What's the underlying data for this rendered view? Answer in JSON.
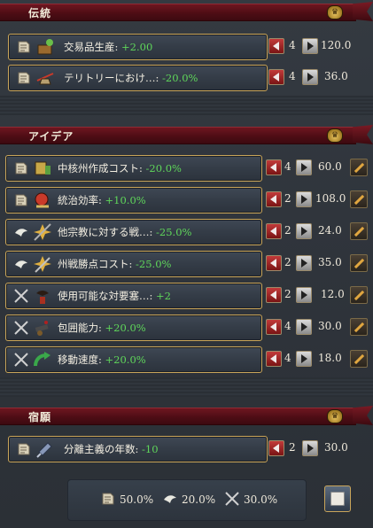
{
  "sections": [
    {
      "title": "伝統",
      "rows": [
        {
          "label": "交易品生産: ",
          "value": "+2.00",
          "level": "4",
          "cost": "120.0",
          "icon": "trade-goods-icon",
          "type": "adm"
        },
        {
          "label": "テリトリーにおけ…: ",
          "value": "-20.0%",
          "level": "4",
          "cost": "36.0",
          "icon": "territory-icon",
          "type": "adm"
        }
      ]
    },
    {
      "title": "アイデア",
      "rows": [
        {
          "label": "中核州作成コスト: ",
          "value": "-20.0%",
          "level": "4",
          "cost": "60.0",
          "icon": "core-cost-icon",
          "type": "adm"
        },
        {
          "label": "統治効率: ",
          "value": "+10.0%",
          "level": "2",
          "cost": "108.0",
          "icon": "efficiency-icon",
          "type": "adm"
        },
        {
          "label": "他宗教に対する戦…: ",
          "value": "-25.0%",
          "level": "2",
          "cost": "24.0",
          "icon": "religion-war-icon",
          "type": "dip"
        },
        {
          "label": "州戦勝点コスト: ",
          "value": "-25.0%",
          "level": "2",
          "cost": "35.0",
          "icon": "warscore-icon",
          "type": "dip"
        },
        {
          "label": "使用可能な対要塞…: ",
          "value": "+2",
          "level": "2",
          "cost": "12.0",
          "icon": "siege-icon",
          "type": "mil"
        },
        {
          "label": "包囲能力: ",
          "value": "+20.0%",
          "level": "4",
          "cost": "30.0",
          "icon": "cannon-icon",
          "type": "mil"
        },
        {
          "label": "移動速度: ",
          "value": "+20.0%",
          "level": "4",
          "cost": "18.0",
          "icon": "movement-arrow-icon",
          "type": "mil"
        }
      ]
    },
    {
      "title": "宿願",
      "rows": [
        {
          "label": "分離主義の年数: ",
          "value": "-10",
          "level": "2",
          "cost": "30.0",
          "icon": "separatism-icon",
          "type": "adm"
        }
      ]
    }
  ],
  "footer": {
    "adm": "50.0%",
    "dip": "20.0%",
    "mil": "30.0%"
  },
  "colors": {
    "positive": "#5fd65a",
    "header_red": "#6e1620",
    "border_gold": "#c9a55a"
  }
}
